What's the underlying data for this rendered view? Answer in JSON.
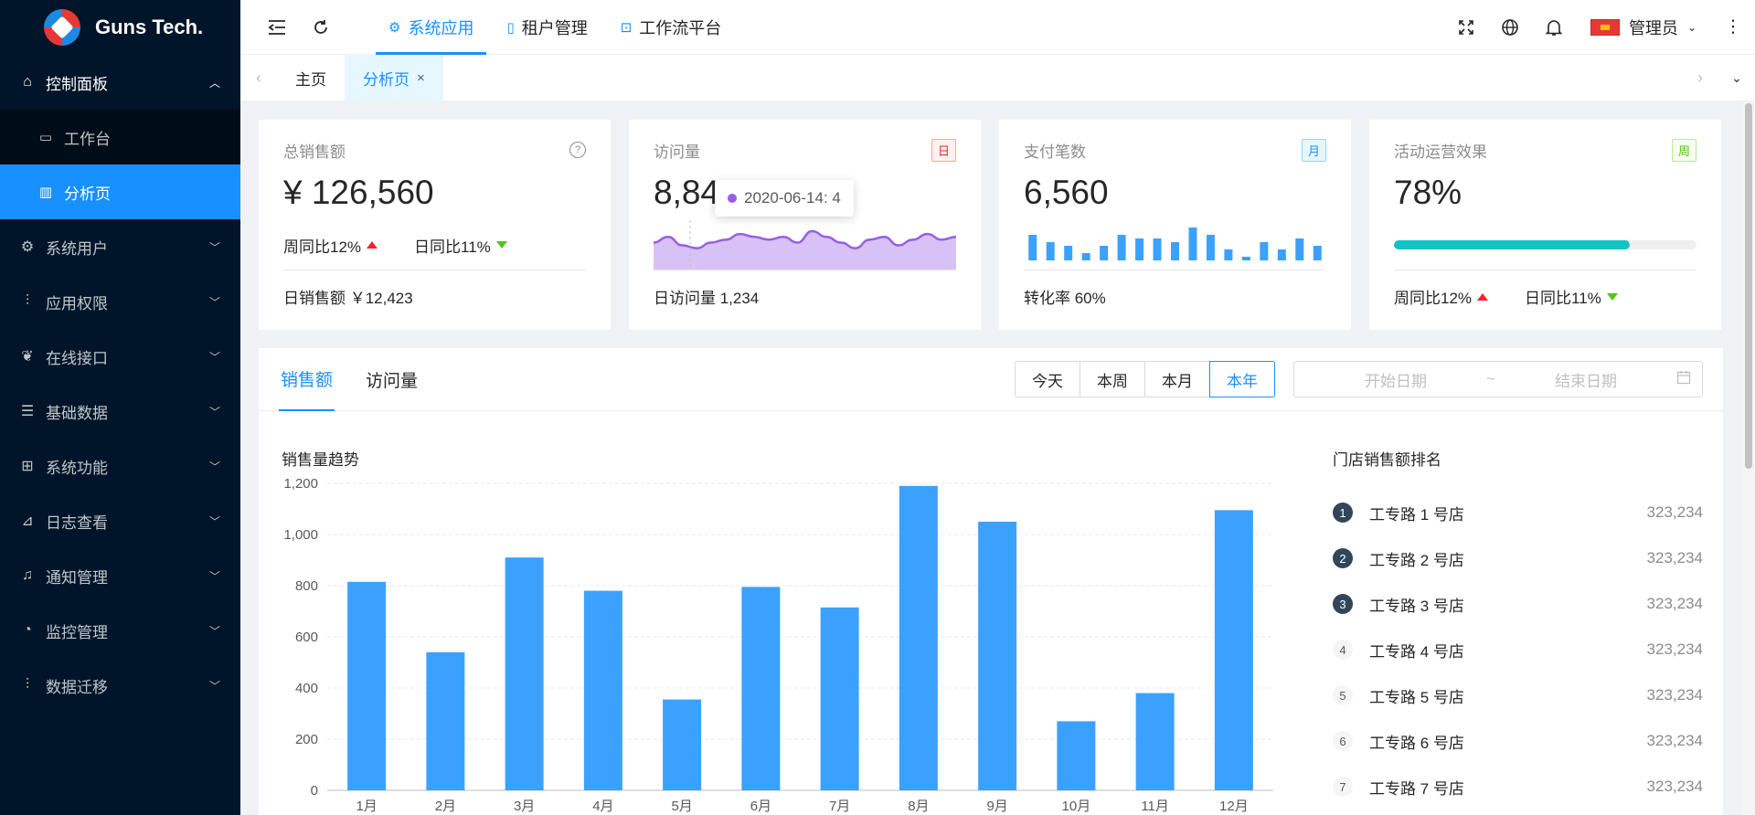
{
  "app": {
    "name": "Guns Tech."
  },
  "sidebar": {
    "menu": [
      {
        "label": "控制面板",
        "icon": "home-icon",
        "open": true,
        "children": [
          {
            "label": "工作台",
            "icon": "monitor-icon"
          },
          {
            "label": "分析页",
            "icon": "bar-chart-icon",
            "active": true
          }
        ]
      },
      {
        "label": "系统用户",
        "icon": "gear-icon"
      },
      {
        "label": "应用权限",
        "icon": "sliders-icon"
      },
      {
        "label": "在线接口",
        "icon": "leaf-icon"
      },
      {
        "label": "基础数据",
        "icon": "document-icon"
      },
      {
        "label": "系统功能",
        "icon": "sitemap-icon"
      },
      {
        "label": "日志查看",
        "icon": "chart-icon"
      },
      {
        "label": "通知管理",
        "icon": "bell-icon"
      },
      {
        "label": "监控管理",
        "icon": "dashboard-icon"
      },
      {
        "label": "数据迁移",
        "icon": "sliders-icon"
      }
    ]
  },
  "header": {
    "tabs": [
      {
        "label": "系统应用",
        "icon": "gear-icon",
        "active": true
      },
      {
        "label": "租户管理",
        "icon": "file-icon"
      },
      {
        "label": "工作流平台",
        "icon": "flow-icon"
      }
    ],
    "user": "管理员"
  },
  "page_tabs": [
    {
      "label": "主页"
    },
    {
      "label": "分析页",
      "active": true,
      "close": "×"
    }
  ],
  "cards": {
    "sales": {
      "title": "总销售额",
      "value": "¥ 126,560",
      "week": "周同比12%",
      "day": "日同比11%",
      "footer": "日销售额 ￥12,423"
    },
    "visits": {
      "title": "访问量",
      "badge": "日",
      "value": "8,846",
      "tooltip": "2020-06-14: 4",
      "footer": "日访问量 1,234"
    },
    "payments": {
      "title": "支付笔数",
      "badge": "月",
      "value": "6,560",
      "footer": "转化率 60%"
    },
    "campaign": {
      "title": "活动运营效果",
      "badge": "周",
      "value": "78%",
      "progress": 0.78,
      "week": "周同比12%",
      "day": "日同比11%"
    }
  },
  "sparkline_data": {
    "visits": [
      5,
      7,
      4,
      3,
      5,
      6,
      8,
      7,
      6,
      7,
      5,
      9,
      7,
      5,
      3,
      6,
      7,
      4,
      6,
      8,
      6,
      7
    ],
    "payments": [
      7,
      5,
      4,
      2,
      4,
      7,
      6,
      6,
      5,
      9,
      7,
      3,
      1,
      5,
      3,
      6,
      4
    ]
  },
  "colors": {
    "primary": "#1890ff",
    "sidebar": "#001529",
    "spark_line": "#975fe4",
    "spark_fill": "#d8c2f5",
    "progress": "#13c2c2",
    "bar": "#3ba1ff"
  },
  "sales_panel": {
    "tabs": [
      "销售额",
      "访问量"
    ],
    "active_tab": 0,
    "ranges": [
      "今天",
      "本周",
      "本月",
      "本年"
    ],
    "active_range": 3,
    "date_start_placeholder": "开始日期",
    "date_sep": "~",
    "date_end_placeholder": "结束日期",
    "chart_title": "销售量趋势",
    "rank_title": "门店销售额排名",
    "rank": [
      {
        "rank": "1",
        "name": "工专路 1 号店",
        "value": "323,234"
      },
      {
        "rank": "2",
        "name": "工专路 2 号店",
        "value": "323,234"
      },
      {
        "rank": "3",
        "name": "工专路 3 号店",
        "value": "323,234"
      },
      {
        "rank": "4",
        "name": "工专路 4 号店",
        "value": "323,234"
      },
      {
        "rank": "5",
        "name": "工专路 5 号店",
        "value": "323,234"
      },
      {
        "rank": "6",
        "name": "工专路 6 号店",
        "value": "323,234"
      },
      {
        "rank": "7",
        "name": "工专路 7 号店",
        "value": "323,234"
      }
    ]
  },
  "chart_data": {
    "type": "bar",
    "categories": [
      "1月",
      "2月",
      "3月",
      "4月",
      "5月",
      "6月",
      "7月",
      "8月",
      "9月",
      "10月",
      "11月",
      "12月"
    ],
    "values": [
      815,
      540,
      910,
      780,
      355,
      795,
      715,
      1190,
      1050,
      270,
      380,
      1095
    ],
    "ylim": [
      0,
      1200
    ],
    "yticks": [
      "0",
      "200",
      "400",
      "600",
      "800",
      "1,000",
      "1,200"
    ],
    "grid": true,
    "title": "销售量趋势"
  }
}
